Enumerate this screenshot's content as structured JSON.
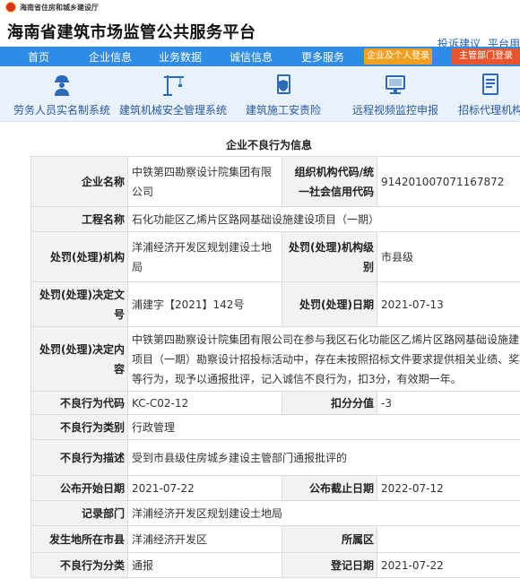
{
  "header": {
    "dept_name": "海南省住房和城乡建设厅",
    "site_title": "海南省建筑市场监管公共服务平台",
    "links": [
      "投诉建议",
      "平台用"
    ]
  },
  "nav": {
    "items": [
      "首页",
      "企业信息",
      "业务数据",
      "诚信信息",
      "更多服务"
    ],
    "personal_login": "企业及个人登录",
    "gov_login": "主管部门登录"
  },
  "systems": [
    {
      "label": "劳务人员实名制系统",
      "icon": "worker-icon"
    },
    {
      "label": "建筑机械安全管理系统",
      "icon": "crane-icon"
    },
    {
      "label": "建筑施工安责险",
      "icon": "insurance-icon"
    },
    {
      "label": "远程视频监控申报",
      "icon": "monitor-icon"
    },
    {
      "label": "招标代理机构",
      "icon": "document-icon"
    }
  ],
  "section_title": "企业不良行为信息",
  "record": {
    "company_label": "企业名称",
    "company": "中铁第四勘察设计院集团有限公司",
    "org_code_label": "组织机构代码/统一社会信用代码",
    "org_code": "914201007071167872",
    "project_label": "工程名称",
    "project": "石化功能区乙烯片区路网基础设施建设项目（一期）",
    "authority_label": "处罚(处理)机构",
    "authority": "洋浦经济开发区规划建设土地局",
    "authority_level_label": "处罚(处理)机构级别",
    "authority_level": "市县级",
    "decision_no_label": "处罚(处理)决定文号",
    "decision_no": "浦建字【2021】142号",
    "penalty_date_label": "处罚(处理)日期",
    "penalty_date": "2021-07-13",
    "decision_content_label": "处罚(处理)决定内容",
    "decision_content": "中铁第四勘察设计院集团有限公司在参与我区石化功能区乙烯片区路网基础设施建设项目（一期）勘察设计招投标活动中，存在未按照招标文件要求提供相关业绩、奖项等行为，现予以通报批评，记入诚信不良行为，扣3分，有效期一年。",
    "behavior_code_label": "不良行为代码",
    "behavior_code": "KC-C02-12",
    "deduction_label": "扣分分值",
    "deduction": "-3",
    "category_label": "不良行为类别",
    "category": "行政管理",
    "description_label": "不良行为描述",
    "description": "受到市县级住房城乡建设主管部门通报批评的",
    "publish_start_label": "公布开始日期",
    "publish_start": "2021-07-22",
    "publish_end_label": "公布截止日期",
    "publish_end": "2022-07-12",
    "record_dept_label": "记录部门",
    "record_dept": "洋浦经济开发区规划建设土地局",
    "location_label": "发生地所在市县",
    "location": "洋浦经济开发区",
    "district_label": "所属区",
    "district": "",
    "classification_label": "不良行为分类",
    "classification": "通报",
    "register_date_label": "登记日期",
    "register_date": "2021-07-22"
  }
}
